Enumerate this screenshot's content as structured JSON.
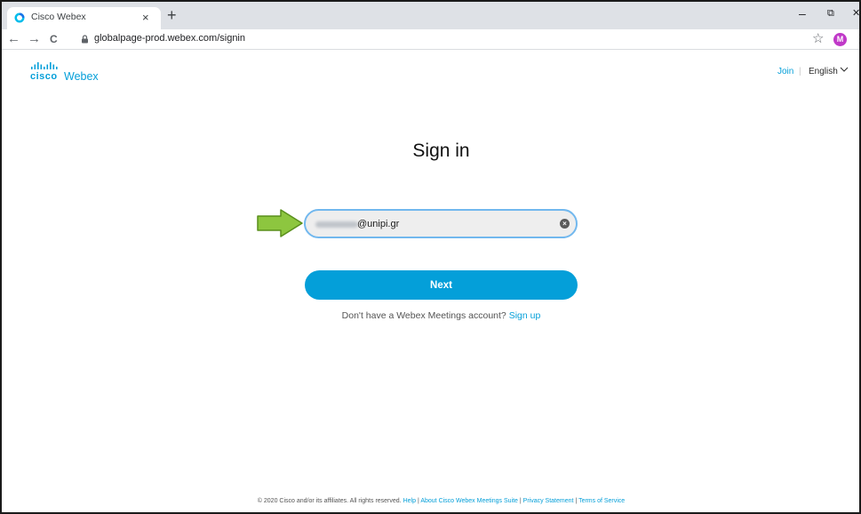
{
  "browser": {
    "tab_title": "Cisco Webex",
    "tab_close": "×",
    "new_tab": "+",
    "url": "globalpage-prod.webex.com/signin",
    "profile_initial": "M",
    "window_min": "–",
    "window_restore": "⧉",
    "window_close": "✕",
    "nav_back_icon": "←",
    "nav_forward_icon": "→",
    "reload_icon": "C",
    "star_icon": "☆",
    "menu_icon": "⋮"
  },
  "header": {
    "logo_cisco": "cisco",
    "logo_webex": "Webex",
    "join_label": "Join",
    "separator": "|",
    "language_label": "English"
  },
  "signin": {
    "title": "Sign in",
    "email_visible_value": "@unipi.gr",
    "next_label": "Next",
    "no_account_text": "Don't have a Webex Meetings account?",
    "signup_label": "Sign up"
  },
  "footer": {
    "copyright": "© 2020 Cisco and/or its affiliates. All rights reserved.",
    "links": [
      "Help",
      "About Cisco Webex Meetings Suite",
      "Privacy Statement",
      "Terms of Service"
    ]
  },
  "colors": {
    "brand": "#049fd9",
    "tabstrip": "#dee1e6",
    "input_border": "#72b8ee",
    "arrow_fill": "#8dc63f",
    "profile": "#c039c8"
  },
  "icons": {
    "favicon": "webex-favicon-icon",
    "lock": "lock-icon",
    "clear": "clear-input-icon",
    "chevron": "chevron-down-icon",
    "arrow": "green-arrow-annotation"
  }
}
